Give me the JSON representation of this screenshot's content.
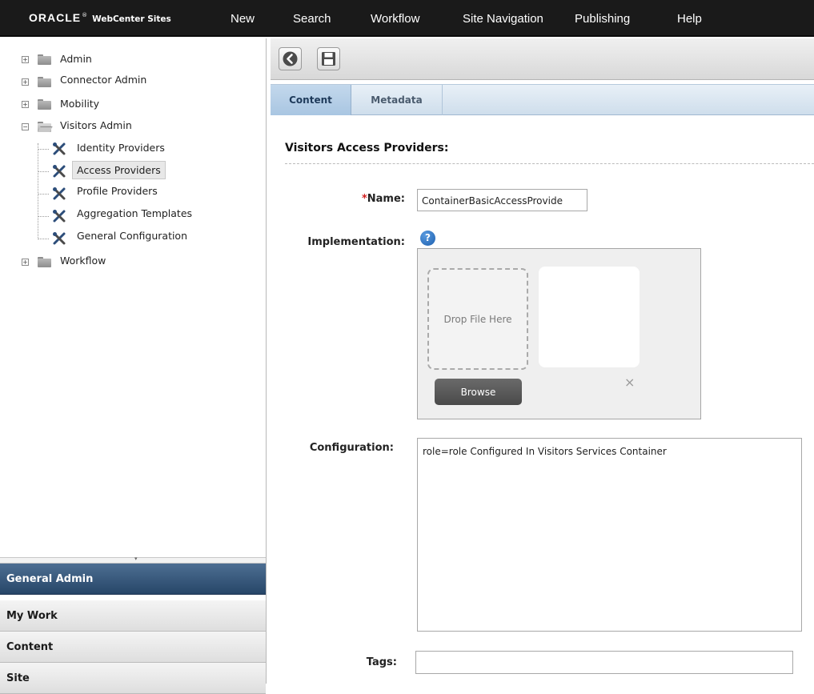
{
  "header": {
    "brand_oracle": "ORACLE",
    "brand_reg": "®",
    "brand_product": "WebCenter Sites",
    "menu": [
      "New",
      "Search",
      "Workflow",
      "Site Navigation",
      "Publishing",
      "Help"
    ]
  },
  "tree": {
    "items": [
      {
        "label": "Admin",
        "expanded": false
      },
      {
        "label": "Connector Admin",
        "expanded": false
      },
      {
        "label": "Mobility",
        "expanded": false
      },
      {
        "label": "Visitors Admin",
        "expanded": true
      },
      {
        "label": "Identity Providers",
        "icon": "wrench-icon"
      },
      {
        "label": "Access Providers",
        "icon": "wrench-icon",
        "selected": true
      },
      {
        "label": "Profile Providers",
        "icon": "wrench-icon"
      },
      {
        "label": "Aggregation Templates",
        "icon": "wrench-icon"
      },
      {
        "label": "General Configuration",
        "icon": "wrench-icon"
      },
      {
        "label": "Workflow",
        "expanded": false
      }
    ],
    "expand_glyph": "+",
    "collapse_glyph": "−"
  },
  "accordion": {
    "items": [
      {
        "label": "General Admin",
        "active": true
      },
      {
        "label": "My Work",
        "active": false
      },
      {
        "label": "Content",
        "active": false
      },
      {
        "label": "Site",
        "active": false
      }
    ]
  },
  "toolbar": {
    "buttons": [
      "back-icon",
      "save-icon"
    ]
  },
  "tabs": [
    {
      "label": "Content",
      "active": true
    },
    {
      "label": "Metadata",
      "active": false
    }
  ],
  "form": {
    "title": "Visitors Access Providers:",
    "name": {
      "required_mark": "*",
      "label": "Name:",
      "value": "ContainerBasicAccessProvide"
    },
    "implementation": {
      "label": "Implementation:",
      "help_glyph": "?",
      "drop_text": "Drop File Here",
      "browse_label": "Browse",
      "remove_glyph": "×"
    },
    "configuration": {
      "label": "Configuration:",
      "value": "role=role Configured In Visitors Services Container"
    },
    "tags": {
      "label": "Tags:",
      "value": ""
    }
  },
  "colors": {
    "topbar": "#1a1a1a",
    "accordion_active": "#274668",
    "tab_active": "#a9c6e2",
    "required": "#d21f1f",
    "help": "#1c5fae"
  }
}
